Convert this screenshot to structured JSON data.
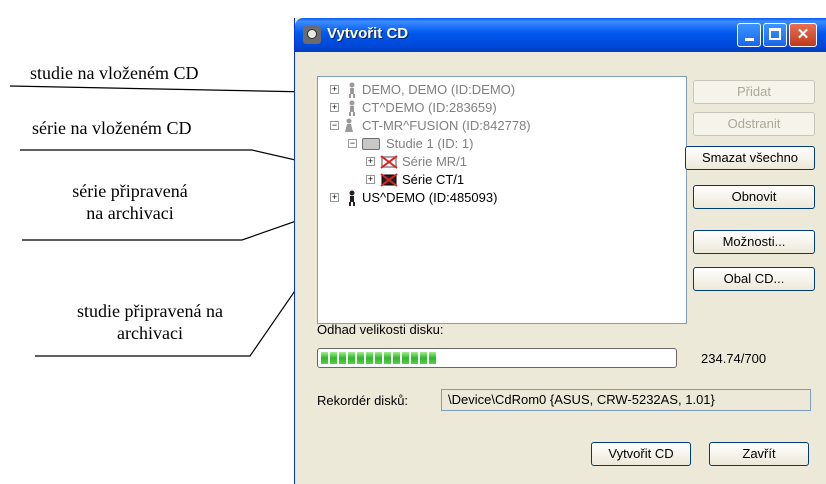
{
  "annotations": [
    {
      "text": "studie na vloženém CD"
    },
    {
      "text": "série na vloženém CD"
    },
    {
      "lines": [
        "série připravená",
        "na archivaci"
      ]
    },
    {
      "lines": [
        "studie připravená na",
        "archivaci"
      ]
    }
  ],
  "window": {
    "title": "Vytvořit CD"
  },
  "tree": [
    {
      "label": "DEMO, DEMO (ID:DEMO)",
      "state": "grey",
      "expander": "+"
    },
    {
      "label": "CT^DEMO (ID:283659)",
      "state": "grey",
      "expander": "+"
    },
    {
      "label": "CT-MR^FUSION (ID:842778)",
      "state": "grey",
      "expander": "-"
    },
    {
      "label": "Studie 1 (ID: 1)",
      "state": "grey",
      "expander": "-"
    },
    {
      "label": "Série MR/1",
      "state": "grey",
      "expander": "+"
    },
    {
      "label": "Série CT/1",
      "state": "black",
      "expander": "+"
    },
    {
      "label": "US^DEMO (ID:485093)",
      "state": "black",
      "expander": "+"
    }
  ],
  "buttons": {
    "add": "Přidat",
    "remove": "Odstranit",
    "clear_all": "Smazat všechno",
    "refresh": "Obnovit",
    "options": "Možnosti...",
    "cd_cover": "Obal CD...",
    "create": "Vytvořit CD",
    "close": "Zavřít"
  },
  "disk": {
    "estimate_label": "Odhad velikosti disku:",
    "size_text": "234.74/700",
    "progress_fraction": 0.335
  },
  "recorder": {
    "label": "Rekordér disků:",
    "value": "\\Device\\CdRom0 {ASUS, CRW-5232AS, 1.01}"
  },
  "colors": {
    "titlebar": "#0058ee",
    "progress": "#2fb52a",
    "disabled_text": "#808080"
  }
}
